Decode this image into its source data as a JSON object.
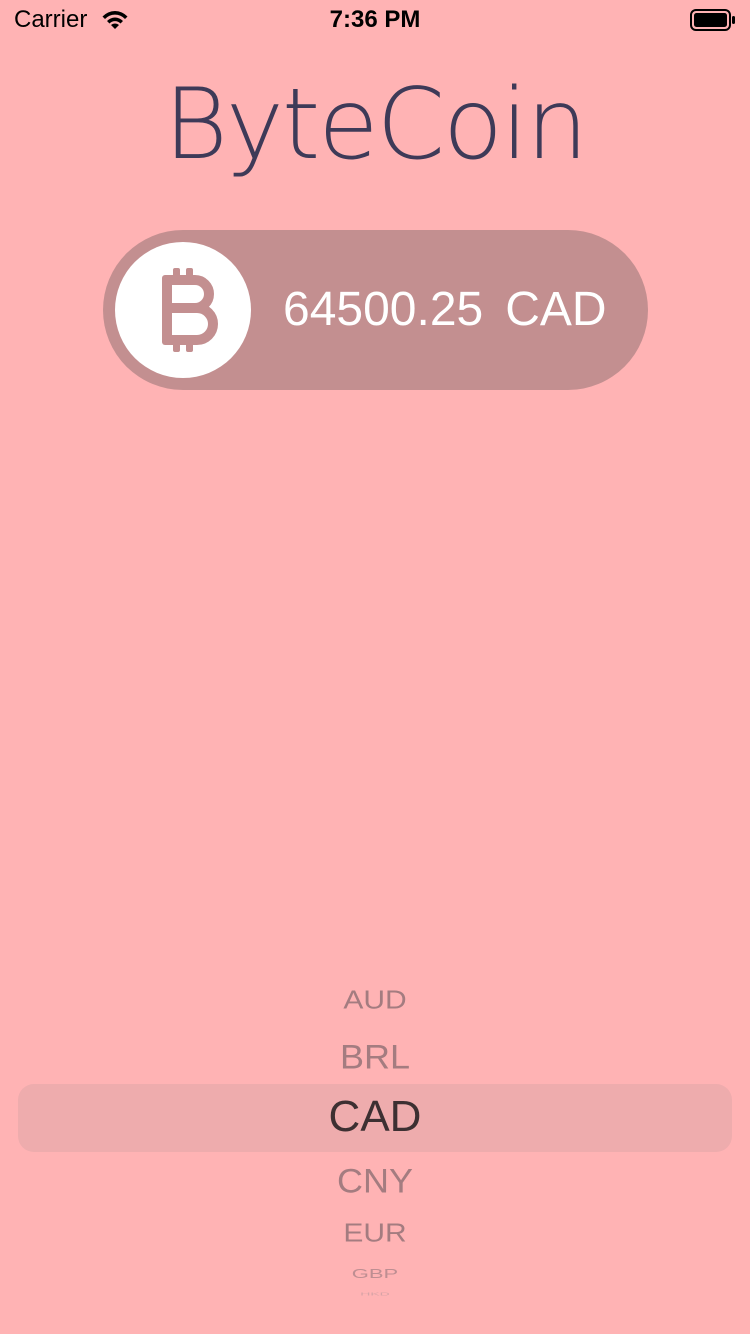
{
  "status_bar": {
    "carrier": "Carrier",
    "time": "7:36 PM",
    "wifi_icon": "wifi-icon",
    "battery_icon": "battery-icon"
  },
  "app": {
    "title": "ByteCoin"
  },
  "coin_view": {
    "icon": "bitcoin-icon",
    "rate": "64500.25",
    "currency": "CAD"
  },
  "picker": {
    "items": [
      "AUD",
      "BRL",
      "CAD",
      "CNY",
      "EUR",
      "GBP",
      "HKD"
    ],
    "selected": "CAD"
  },
  "colors": {
    "background": "#FFB3B4",
    "title": "#3E3A58",
    "pill": "#C38F90",
    "coin_circle": "#FFFFFF",
    "bitcoin_symbol": "#C38F90"
  }
}
